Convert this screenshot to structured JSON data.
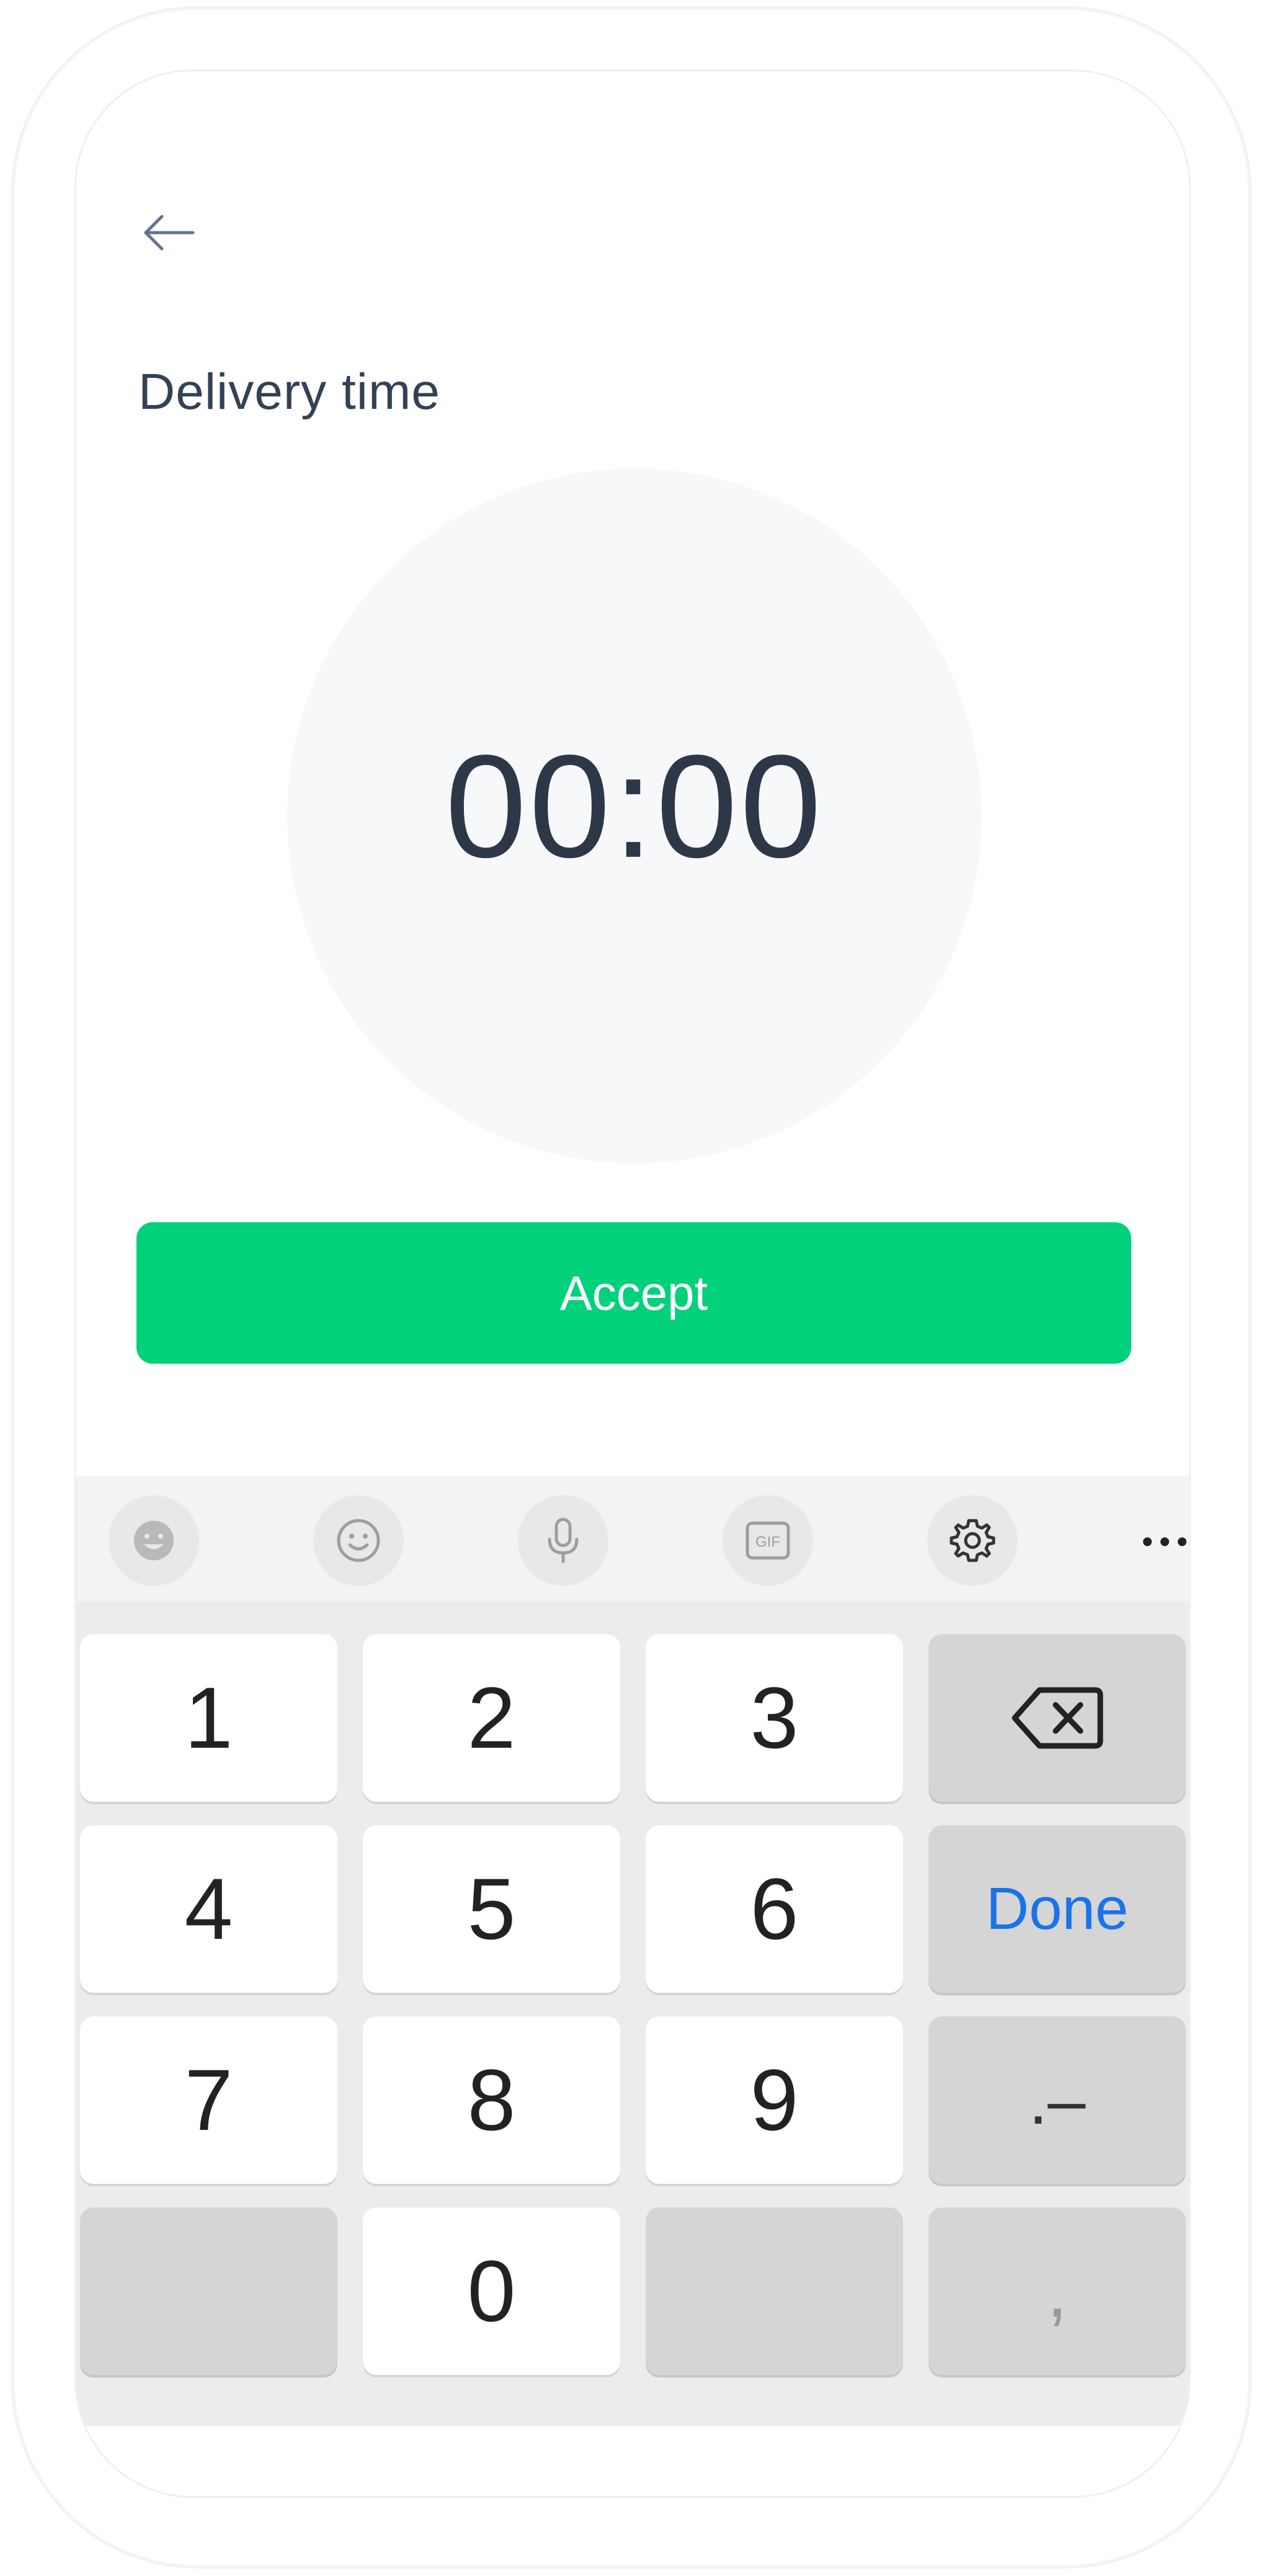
{
  "header": {
    "title": "Delivery time"
  },
  "timer": {
    "value": "00:00"
  },
  "actions": {
    "accept_label": "Accept"
  },
  "keyboard": {
    "toolbar": [
      {
        "icon": "sticker-icon"
      },
      {
        "icon": "emoji-icon"
      },
      {
        "icon": "microphone-icon"
      },
      {
        "icon": "gif-icon",
        "label": "GIF"
      },
      {
        "icon": "gear-icon"
      },
      {
        "icon": "more-icon",
        "label": "..."
      }
    ],
    "keys": {
      "k1": "1",
      "k2": "2",
      "k3": "3",
      "k4": "4",
      "k5": "5",
      "k6": "6",
      "k7": "7",
      "k8": "8",
      "k9": "9",
      "k0": "0",
      "done": "Done",
      "dot_minus": ".–",
      "comma": ","
    }
  },
  "colors": {
    "accent": "#02d17c",
    "done_blue": "#1a73e8",
    "title_text": "#334155",
    "timer_text": "#2d3748"
  }
}
